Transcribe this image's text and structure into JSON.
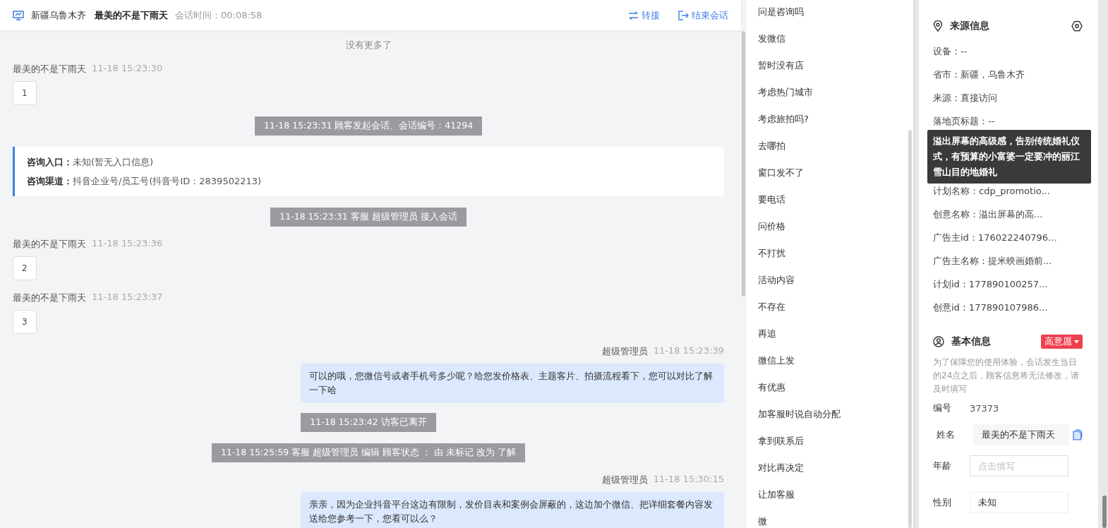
{
  "header": {
    "region": "新疆乌鲁木齐",
    "visitor": "最美的不是下雨天",
    "duration": "会话时间：00:08:58",
    "actions": [
      {
        "label": "转接",
        "kind": "transfer"
      },
      {
        "label": "结束会话",
        "kind": "end"
      }
    ]
  },
  "chat": {
    "no_more": "没有更多了",
    "messages": [
      {
        "kind": "customer",
        "name": "最美的不是下雨天",
        "time": "11-18 15:23:30",
        "text": "1"
      },
      {
        "kind": "system",
        "text": "11-18 15:23:31 顾客发起会话、会话编号：41294"
      },
      {
        "kind": "entry",
        "rows": [
          {
            "label": "咨询入口：",
            "value": "未知(暂无入口信息)"
          },
          {
            "label": "咨询渠道：",
            "value": "抖音企业号/员工号(抖音号ID：2839502213)"
          }
        ]
      },
      {
        "kind": "system",
        "text": "11-18 15:23:31 客服 超级管理员 接入会话"
      },
      {
        "kind": "customer",
        "name": "最美的不是下雨天",
        "time": "11-18 15:23:36",
        "text": "2"
      },
      {
        "kind": "customer",
        "name": "最美的不是下雨天",
        "time": "11-18 15:23:37",
        "text": "3"
      },
      {
        "kind": "agent",
        "name": "超级管理员",
        "time": "11-18 15:23:39",
        "text": "可以的哦，您微信号或者手机号多少呢？给您发价格表、主题客片、拍摄流程看下，您可以对比了解一下哈"
      },
      {
        "kind": "system",
        "text": "11-18 15:23:42 访客已离开"
      },
      {
        "kind": "system",
        "text": "11-18 15:25:59 客服 超级管理员 编辑 顾客状态 ： 由 未标记 改为 了解"
      },
      {
        "kind": "agent",
        "name": "超级管理员",
        "time": "11-18 15:30:15",
        "text": "亲亲，因为企业抖音平台这边有限制，发价目表和案例会屏蔽的，这边加个微信、把详细套餐内容发送给您参考一下，您看可以么？"
      }
    ]
  },
  "quick_replies": [
    "问是咨询吗",
    "发微信",
    "暂时没有店",
    "考虑热门城市",
    "考虑旅拍吗?",
    "去哪拍",
    "窗口发不了",
    "要电话",
    "问价格",
    "不打扰",
    "活动内容",
    "不存在",
    "再追",
    "微信上发",
    "有优惠",
    "加客服时说自动分配",
    "拿到联系后",
    "对比再决定",
    "让加客服",
    "微"
  ],
  "source_info": {
    "title": "来源信息",
    "rows_above": [
      "设备：--",
      "省市：新疆，乌鲁木齐",
      "来源：直接访问",
      "落地页标题：--"
    ],
    "tooltip": "溢出屏幕的高级感，告别传统婚礼仪式，有预算的小富婆一定要冲的丽江雪山目的地婚礼",
    "rows_below": [
      "计划名称：cdp_promotio...",
      "创意名称：溢出屏幕的高...",
      "广告主id：176022240796...",
      "广告主名称：提米映画婚前...",
      "计划id：177890100257...",
      "创意id：177890107986..."
    ]
  },
  "basic_info": {
    "title": "基本信息",
    "tag": "高意愿",
    "notice": "为了保障您的使用体验，会话发生当日的24点之后，顾客信息将无法修改，请及时填写",
    "fields": [
      {
        "kind": "plain",
        "label": "编号",
        "value": "37373"
      },
      {
        "kind": "copy",
        "label": "姓名",
        "value": "最美的不是下雨天"
      },
      {
        "kind": "input",
        "label": "年龄",
        "placeholder": "点击填写"
      },
      {
        "kind": "box",
        "label": "性别",
        "value": "未知"
      }
    ]
  }
}
